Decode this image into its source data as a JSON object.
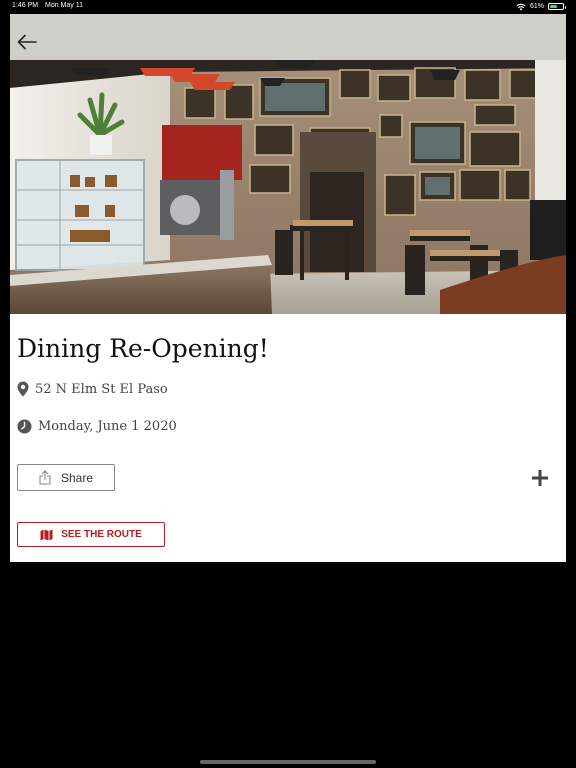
{
  "status_bar": {
    "time": "1:46 PM",
    "date": "Mon May 11",
    "battery": "61%",
    "battery_level": 0.61
  },
  "header": {
    "back_icon": "arrow-left-icon"
  },
  "hero": {
    "subject": "restaurant-interior-photo"
  },
  "event": {
    "title": "Dining Re-Opening!",
    "address": "52 N Elm St El Paso",
    "date": "Monday, June 1 2020"
  },
  "actions": {
    "share_label": "Share",
    "route_label": "SEE THE ROUTE",
    "add_icon": "plus-icon"
  },
  "colors": {
    "accent": "#b81c1c",
    "topbar": "#cfcfca"
  }
}
